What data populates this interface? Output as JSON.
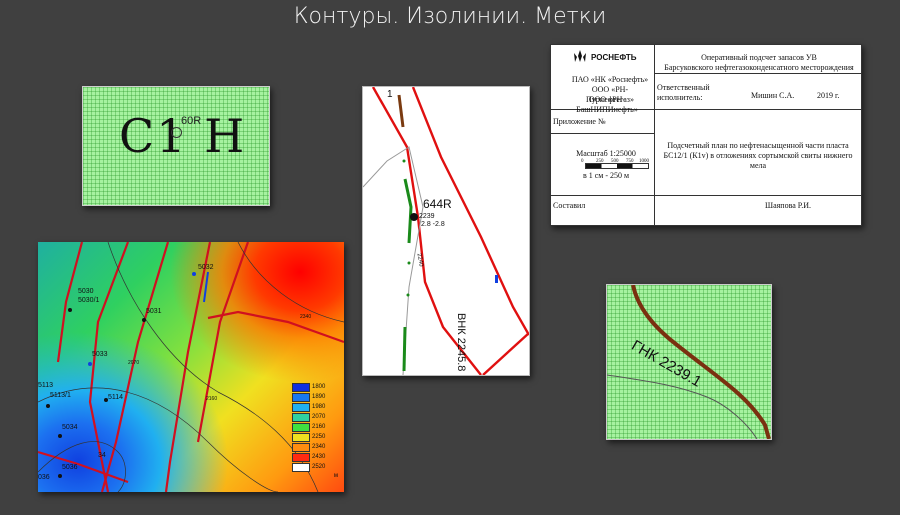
{
  "slide": {
    "title": "Контуры. Изолинии. Метки"
  },
  "panel1": {
    "big_label": "C1 H",
    "small_tag": "60R"
  },
  "panel2": {
    "well_label": "644R",
    "well_depth": "2239",
    "well_sub": "2.8 -2.8",
    "contour_label": "2240",
    "vnk_label": "ВНК 2245.8",
    "corner_label": "1"
  },
  "panel3": {
    "company": [
      "ПАО «НК «Роснефть»",
      "ООО «РН-Пурнефтегаз»",
      "ООО «РН-БашНИПИнефть»"
    ],
    "logo_text": "РОСНЕФТЬ",
    "header_line1": "Оперативный подсчет запасов УВ",
    "header_line2": "Барсуковского нефтегазоконденсатного месторождения",
    "responsible": "Ответственный исполнитель:",
    "responsible_name": "Мишин С.А.",
    "year": "2019 г.",
    "appendix": "Приложение №",
    "scale": "Масштаб 1:25000",
    "scale_ticks": [
      "0",
      "250",
      "500",
      "750",
      "1000"
    ],
    "scale_note": "в 1 см - 250 м",
    "plan_title": "Подсчетный план по нефтенасыщенной части пласта БС12/1 (К1v) в отложениях сортымской свиты нижнего мела",
    "compiled": "Составил",
    "compiler": "Шаяпова Р.И."
  },
  "panel4": {
    "gnk_label": "ГНК 2239.1"
  },
  "panel5": {
    "wells": [
      "5030",
      "5030/1",
      "5032",
      "5031",
      "5033",
      "5114",
      "5113",
      "5113/1",
      "5034",
      "5036",
      "34",
      "036"
    ],
    "contours": [
      "2070",
      "2160",
      "2340"
    ],
    "legend": [
      {
        "value": "1800",
        "color": "#1030e0"
      },
      {
        "value": "1890",
        "color": "#1878f0"
      },
      {
        "value": "1980",
        "color": "#20b0f0"
      },
      {
        "value": "2070",
        "color": "#30d0a0"
      },
      {
        "value": "2160",
        "color": "#40e040"
      },
      {
        "value": "2250",
        "color": "#f0e020"
      },
      {
        "value": "2340",
        "color": "#ff8c10"
      },
      {
        "value": "2430",
        "color": "#ff2a10"
      },
      {
        "value": "2520",
        "color": "#ffffff"
      }
    ],
    "unit": "м"
  }
}
